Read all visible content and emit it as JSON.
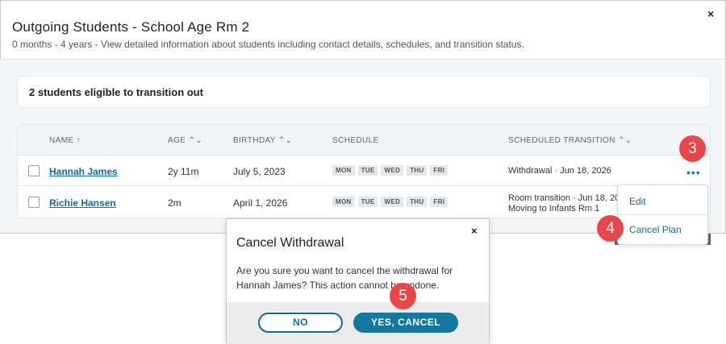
{
  "modal": {
    "title": "Outgoing Students - School Age Rm 2",
    "subtitle": "0 months - 4 years - View detailed information about students including contact details, schedules, and transition status.",
    "close": "×"
  },
  "summary": "2 students eligible to transition out",
  "table": {
    "headers": {
      "name": "NAME ↑",
      "age": "AGE ⌃⌄",
      "birthday": "BIRTHDAY ⌃⌄",
      "schedule": "SCHEDULE",
      "transition": "SCHEDULED TRANSITION ⌃⌄"
    },
    "rows": [
      {
        "name": "Hannah James",
        "age": "2y 11m",
        "birthday": "July 5, 2023",
        "days": [
          "MON",
          "TUE",
          "WED",
          "THU",
          "FRI"
        ],
        "transition_line1": "Withdrawal · Jun 18, 2026",
        "transition_line2": ""
      },
      {
        "name": "Richie Hansen",
        "age": "2m",
        "birthday": "April 1, 2026",
        "days": [
          "MON",
          "TUE",
          "WED",
          "THU",
          "FRI"
        ],
        "transition_line1": "Room transition · Jun 18, 20",
        "transition_line2": "Moving to Infants Rm 1"
      }
    ]
  },
  "row_menu": {
    "trigger": "•••",
    "items": [
      "Edit",
      "Cancel Plan"
    ]
  },
  "dialog": {
    "title": "Cancel Withdrawal",
    "close": "×",
    "message": "Are you sure you want to cancel the withdrawal for Hannah James? This action cannot be undone.",
    "no_label": "NO",
    "yes_label": "YES, CANCEL"
  },
  "step_badges": [
    "3",
    "4",
    "5"
  ],
  "colors": {
    "link": "#0f6e98",
    "primary_button": "#13789f",
    "badge": "#ea4548"
  }
}
